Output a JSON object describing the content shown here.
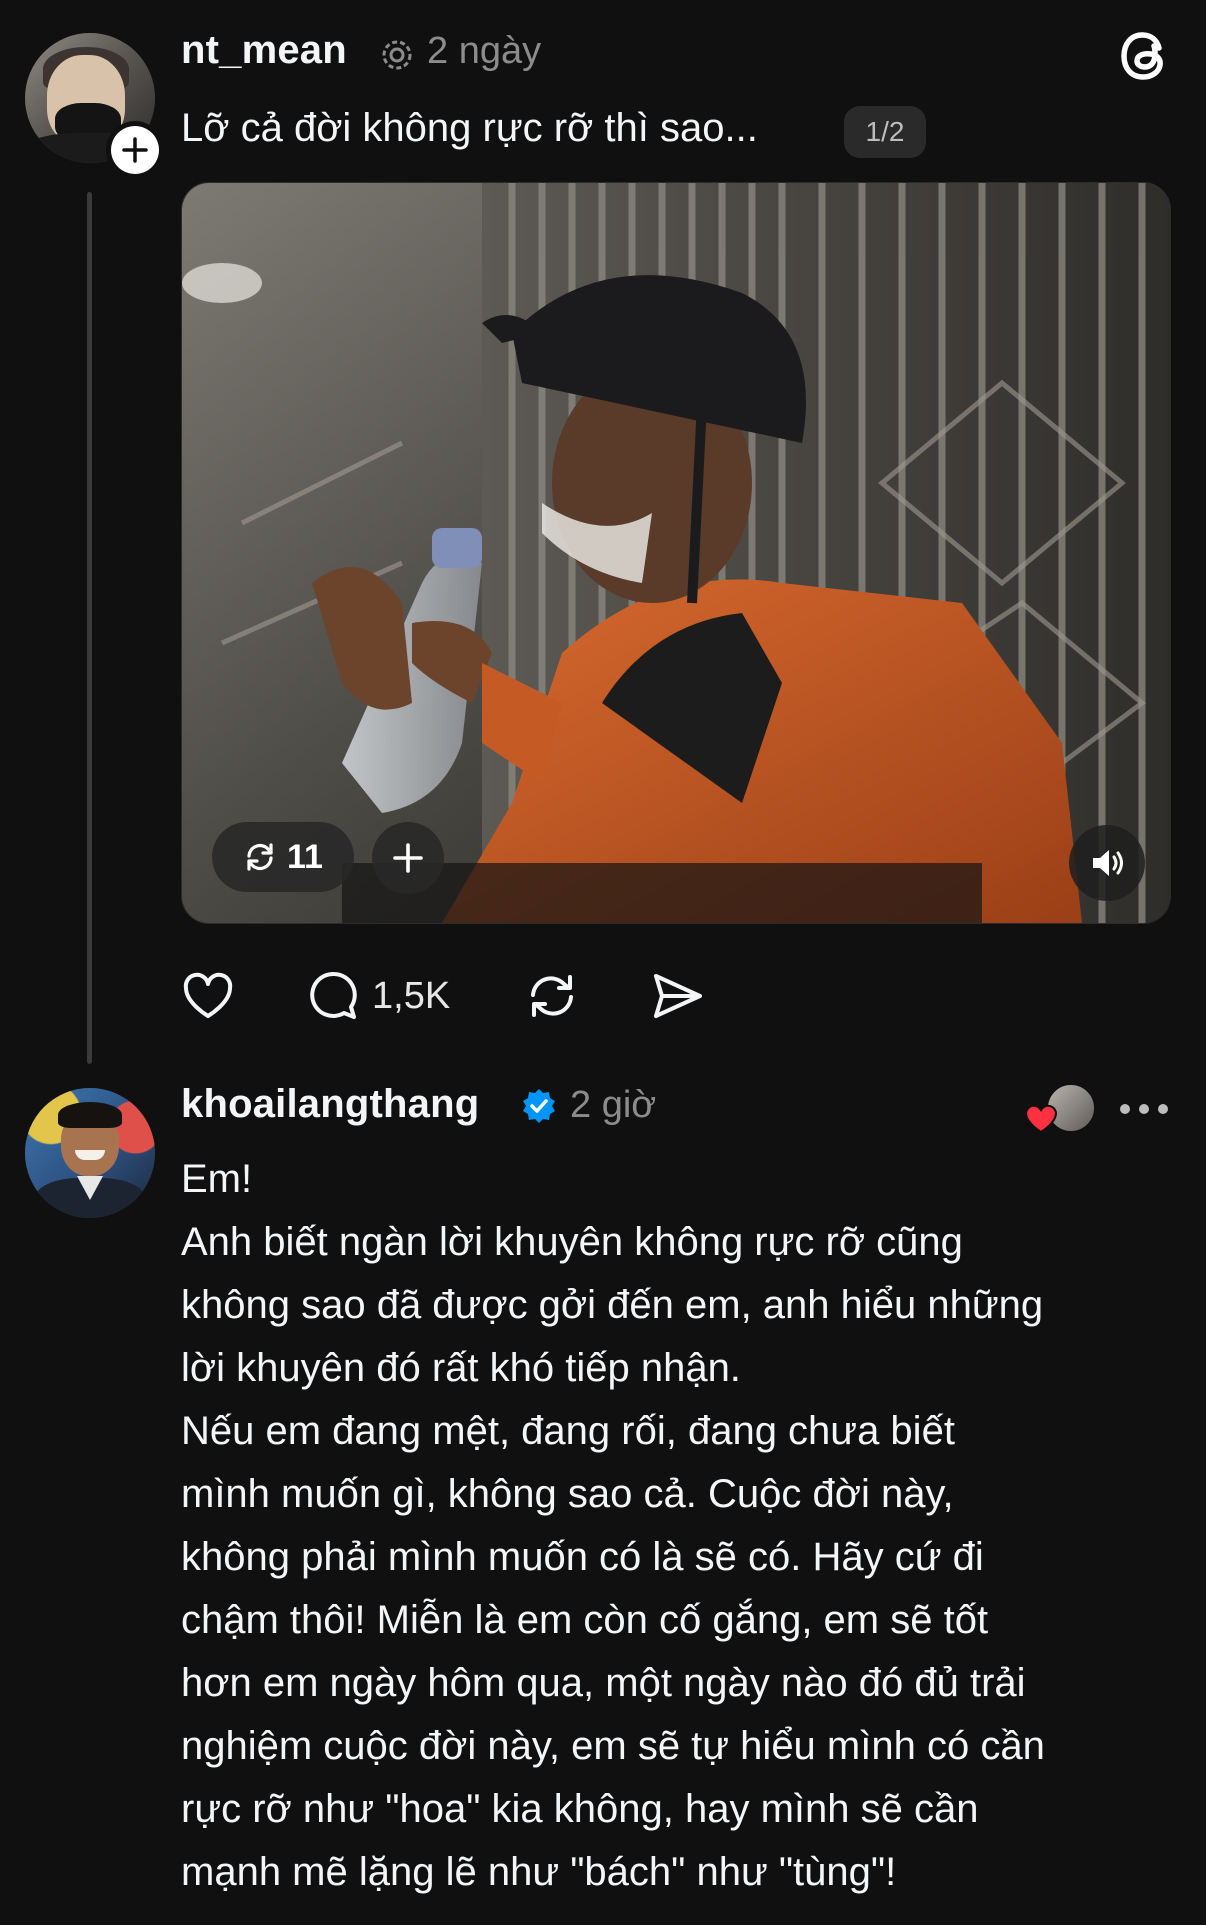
{
  "post": {
    "username": "nt_mean",
    "time": "2 ngày",
    "caption": "Lỡ cả đời không rực rỡ thì sao...",
    "pager": "1/2",
    "media_repost_count": "11",
    "actions": {
      "reply_count": "1,5K"
    }
  },
  "reply": {
    "username": "khoailangthang",
    "verified": true,
    "time": "2 giờ",
    "paragraphs": [
      "Em!",
      "Anh biết ngàn lời khuyên không rực rỡ cũng\nkhông sao đã được gởi đến em, anh hiểu những\nlời khuyên đó rất khó tiếp nhận.",
      "Nếu em đang mệt, đang rối, đang chưa biết\nmình muốn gì, không sao cả. Cuộc đời này,\nkhông phải mình muốn có là sẽ có. Hãy cứ đi\nchậm thôi! Miễn là em còn cố gắng, em sẽ tốt\nhơn em ngày hôm qua, một ngày nào đó đủ trải\nnghiệm cuộc đời này, em sẽ tự hiểu mình có cần\nrực rỡ như \"hoa\" kia không, hay mình sẽ cần\nmạnh mẽ lặng lẽ như \"bách\" như \"tùng\"!"
    ]
  },
  "icons": {
    "threads_logo": "threads-logo-icon",
    "activity": "reel-ring-icon",
    "repost": "repost-icon",
    "like": "heart-icon",
    "reply": "comment-bubble-icon",
    "share": "send-icon",
    "sound": "speaker-icon",
    "more": "more-dots-icon",
    "verified": "verified-badge-icon"
  },
  "colors": {
    "background": "#101010",
    "text": "#f3f5f7",
    "muted": "#8c8c8c",
    "verified": "#0095f6",
    "heart": "#ff3040",
    "jacket": "#d2642a"
  }
}
